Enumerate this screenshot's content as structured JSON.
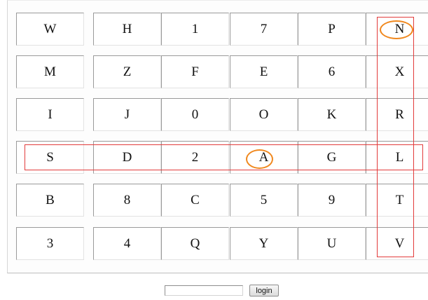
{
  "keypad": {
    "rows": [
      [
        "W",
        "H",
        "1",
        "7",
        "P",
        "N"
      ],
      [
        "M",
        "Z",
        "F",
        "E",
        "6",
        "X"
      ],
      [
        "I",
        "J",
        "0",
        "O",
        "K",
        "R"
      ],
      [
        "S",
        "D",
        "2",
        "A",
        "G",
        "L"
      ],
      [
        "B",
        "8",
        "C",
        "5",
        "9",
        "T"
      ],
      [
        "3",
        "4",
        "Q",
        "Y",
        "U",
        "V"
      ]
    ]
  },
  "annotations": {
    "highlighted_row": [
      "S",
      "D",
      "2",
      "A",
      "G",
      "L"
    ],
    "highlighted_column": [
      "N",
      "X",
      "R",
      "L",
      "T",
      "V"
    ],
    "circled_keys": [
      "N",
      "A"
    ],
    "box_color": "#e23b3b",
    "circle_color": "#f0881e"
  },
  "login_form": {
    "password_value": "",
    "button_label": "login"
  }
}
